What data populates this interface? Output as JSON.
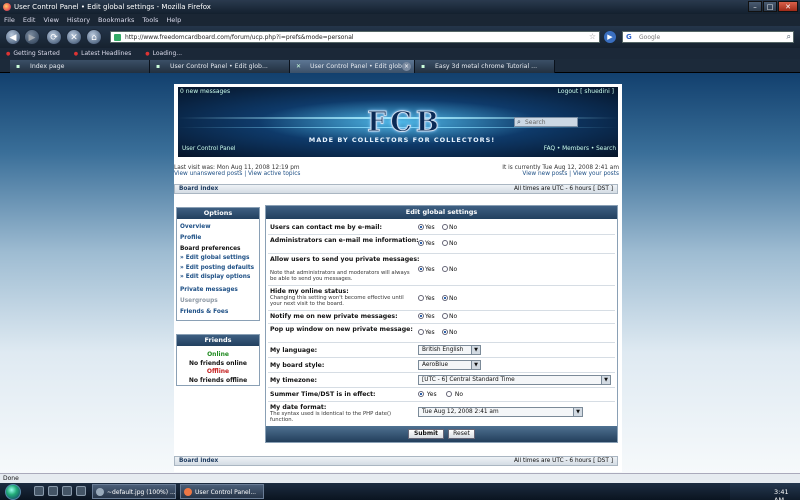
{
  "window": {
    "title": "User Control Panel • Edit global settings - Mozilla Firefox"
  },
  "menu": [
    "File",
    "Edit",
    "View",
    "History",
    "Bookmarks",
    "Tools",
    "Help"
  ],
  "nav": {
    "url": "http://www.freedomcardboard.com/forum/ucp.php?i=prefs&mode=personal",
    "search_placeholder": "Google"
  },
  "bookmarks": [
    "Getting Started",
    "Latest Headlines",
    "Loading..."
  ],
  "tabs": [
    {
      "label": "Index page",
      "active": false
    },
    {
      "label": "User Control Panel • Edit glob...",
      "active": false
    },
    {
      "label": "User Control Panel • Edit glob...",
      "active": true
    },
    {
      "label": "Easy 3d metal chrome Tutorial ...",
      "active": false
    }
  ],
  "banner": {
    "new_messages": "0 new messages",
    "logout": "Logout [ shuedini ]",
    "logo": "FCB",
    "tagline": "MADE BY COLLECTORS FOR COLLECTORS!",
    "search_placeholder": "Search",
    "ucp_link": "User Control Panel",
    "right_links": "FAQ • Members • Search"
  },
  "info": {
    "last_visit": "Last visit was: Mon Aug 11, 2008 12:19 pm",
    "left_links": "View unanswered posts | View active topics",
    "current_time": "It is currently Tue Aug 12, 2008 2:41 am",
    "right_links": "View new posts | View your posts"
  },
  "crumb": {
    "index": "Board index",
    "tz": "All times are UTC - 6 hours [ DST ]"
  },
  "options": {
    "title": "Options",
    "items": [
      "Overview",
      "Profile",
      "Board preferences",
      "» Edit global settings",
      "» Edit posting defaults",
      "» Edit display options",
      "Private messages",
      "Usergroups",
      "Friends & Foes"
    ]
  },
  "friends": {
    "title": "Friends",
    "online": "Online",
    "no_online": "No friends online",
    "offline": "Offline",
    "no_offline": "No friends offline"
  },
  "settings": {
    "title": "Edit global settings",
    "yes": "Yes",
    "no": "No",
    "rows": [
      {
        "label": "Users can contact me by e-mail:",
        "sub": "",
        "value": "yes"
      },
      {
        "label": "Administrators can e-mail me information:",
        "sub": "",
        "value": "yes"
      },
      {
        "label": "Allow users to send you private messages:",
        "sub": "Note that administrators and moderators will always be able to send you messages.",
        "value": "yes"
      },
      {
        "label": "Hide my online status:",
        "sub": "Changing this setting won't become effective until your next visit to the board.",
        "value": "no"
      },
      {
        "label": "Notify me on new private messages:",
        "sub": "",
        "value": "yes"
      },
      {
        "label": "Pop up window on new private message:",
        "sub": "",
        "value": "no"
      }
    ],
    "language_label": "My language:",
    "language": "British English",
    "style_label": "My board style:",
    "style": "AeroBlue",
    "timezone_label": "My timezone:",
    "timezone": "[UTC - 6] Central Standard Time",
    "dst_label": "Summer Time/DST is in effect:",
    "dst_value": "yes",
    "date_label": "My date format:",
    "date_sub": "The syntax used is identical to the PHP date() function.",
    "date_value": "Tue Aug 12, 2008 2:41 am",
    "submit": "Submit",
    "reset": "Reset"
  },
  "status": "Done",
  "taskbar": {
    "items": [
      "~default.jpg (100%) ...",
      "User Control Panel..."
    ],
    "time": "3:41 AM"
  }
}
